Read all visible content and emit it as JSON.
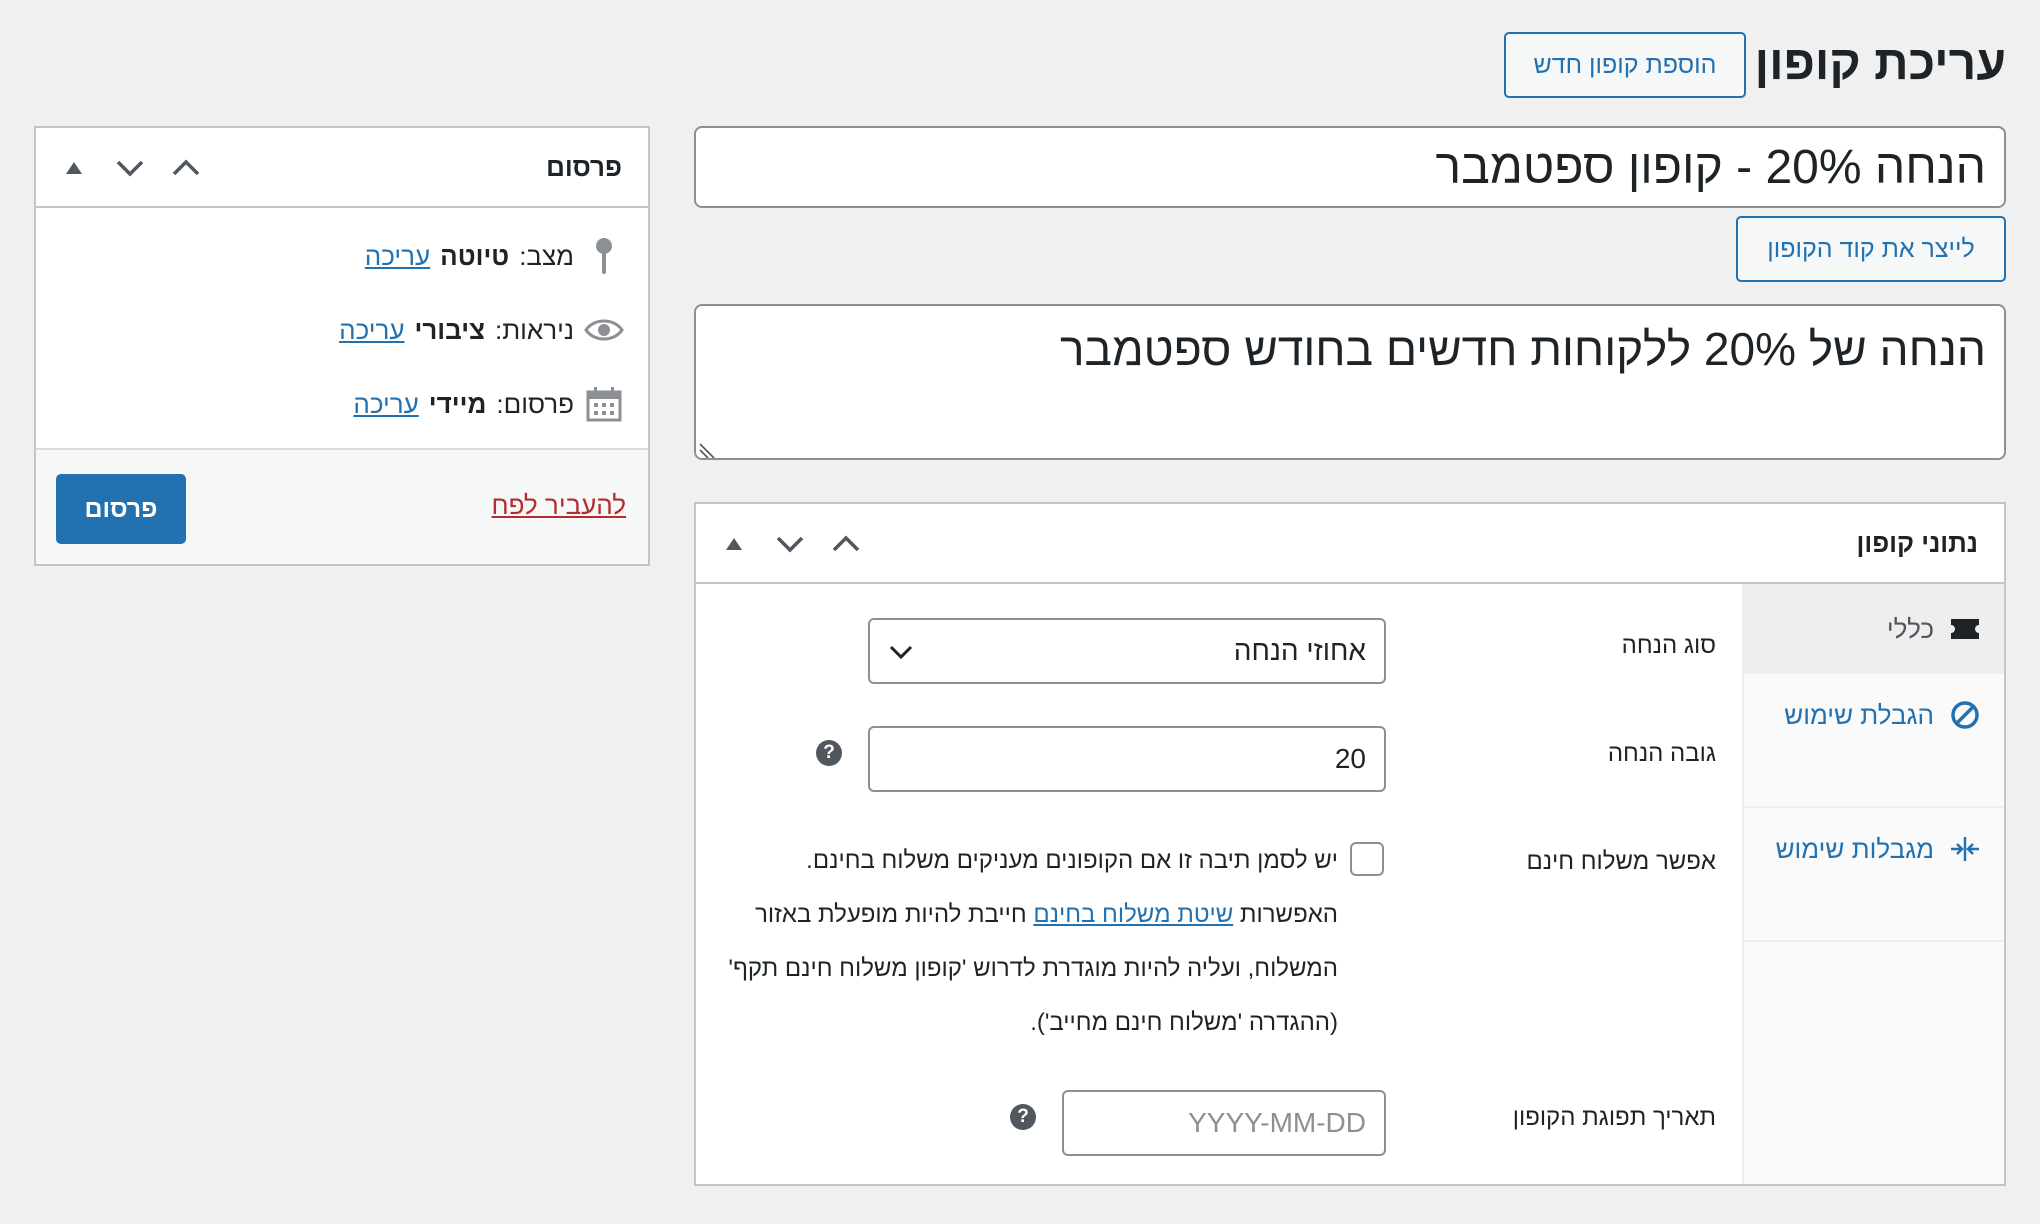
{
  "header": {
    "page_title": "עריכת קופון",
    "add_new_label": "הוספת קופון חדש"
  },
  "coupon": {
    "title": "הנחה 20% - קופון ספטמבר",
    "generate_code_label": "לייצר את קוד הקופון",
    "description": "הנחה של 20% ללקוחות חדשים בחודש ספטמבר"
  },
  "publish_box": {
    "title": "פרסום",
    "status_label": "מצב:",
    "status_value": "טיוטה",
    "visibility_label": "ניראות:",
    "visibility_value": "ציבורי",
    "publish_time_label": "פרסום:",
    "publish_time_value": "מיידי",
    "edit_link": "עריכה",
    "trash_label": "להעביר לפח",
    "publish_button": "פרסום"
  },
  "coupon_data": {
    "title": "נתוני קופון",
    "tabs": [
      {
        "label": "כללי",
        "icon": "ticket-icon",
        "active": true
      },
      {
        "label": "הגבלת שימוש",
        "icon": "block-icon",
        "active": false
      },
      {
        "label": "מגבלות שימוש",
        "icon": "contract-icon",
        "active": false
      }
    ],
    "fields": {
      "discount_type_label": "סוג הנחה",
      "discount_type_value": "אחוזי הנחה",
      "amount_label": "גובה הנחה",
      "amount_value": "20",
      "free_shipping_label": "אפשר משלוח חינם",
      "free_shipping_desc_before": "יש לסמן תיבה זו אם הקופונים מעניקים משלוח בחינם. האפשרות ",
      "free_shipping_link": "שיטת משלוח בחינם",
      "free_shipping_desc_after": " חייבת להיות מופעלת באזור המשלוח, ועליה להיות מוגדרת לדרוש 'קופון משלוח חינם תקף' (ההגדרה 'משלוח חינם מחייב').",
      "expiry_label": "תאריך תפוגת הקופון",
      "expiry_placeholder": "YYYY-MM-DD",
      "help_symbol": "?"
    }
  }
}
